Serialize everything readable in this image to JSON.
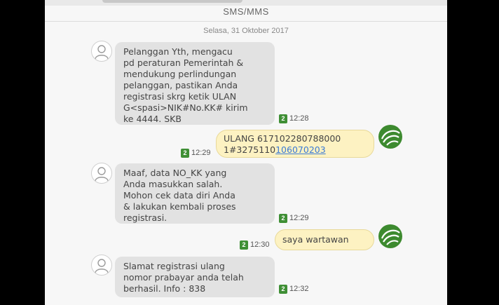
{
  "header": {
    "title": "SMS/MMS",
    "date": "Selasa, 31 Oktober 2017"
  },
  "sim_label": "2",
  "colors": {
    "incoming_bubble": "#e2e2e2",
    "outgoing_bubble": "#fdf2c2",
    "sim_badge": "#3f8f35",
    "link": "#3a7bd5"
  },
  "messages": [
    {
      "direction": "incoming",
      "text": "Pelanggan Yth, mengacu\npd peraturan Pemerintah &\nmendukung perlindungan\npelanggan, pastikan Anda\nregistrasi skrg ketik ULAN\nG<spasi>NIK#No.KK# kirim\nke 4444. SKB",
      "time": "12:28"
    },
    {
      "direction": "outgoing",
      "text_line1": "ULANG 617102280788000",
      "text_line2_plain": "1#3275110",
      "text_line2_link": "106070203",
      "time": "12:29"
    },
    {
      "direction": "incoming",
      "text": "Maaf, data NO_KK yang\nAnda masukkan salah.\nMohon cek data diri Anda\n& lakukan kembali proses\nregistrasi.",
      "time": "12:29"
    },
    {
      "direction": "outgoing",
      "text": "saya wartawan",
      "time": "12:30"
    },
    {
      "direction": "incoming",
      "text": "Slamat registrasi ulang\nnomor prabayar anda telah\nberhasil. Info : 838",
      "time": "12:32"
    }
  ]
}
